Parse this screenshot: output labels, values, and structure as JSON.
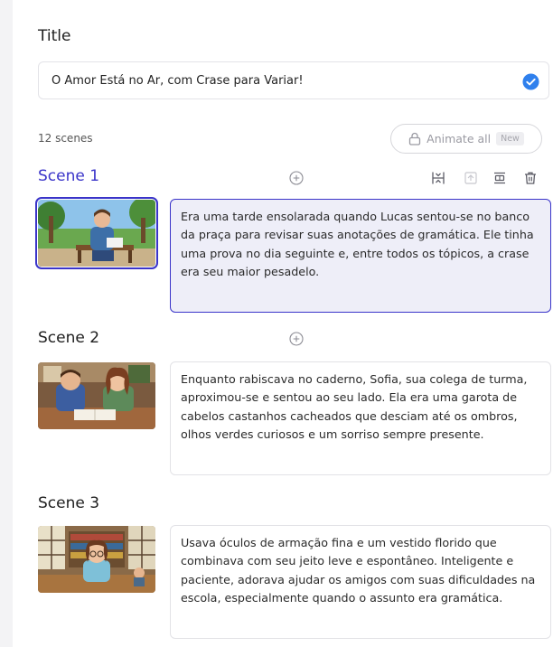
{
  "form": {
    "title_label": "Title",
    "title_value": "O Amor Está no Ar, com Crase para Variar!",
    "scene_count": "12 scenes",
    "animate_all_label": "Animate all",
    "animate_all_badge": "New"
  },
  "scenes": [
    {
      "title": "Scene 1",
      "text": "Era uma tarde ensolarada quando Lucas sentou-se no banco da praça para revisar suas anotações de gramática. Ele tinha uma prova no dia seguinte e, entre todos os tópicos, a crase era seu maior pesadelo."
    },
    {
      "title": "Scene 2",
      "text": "Enquanto rabiscava no caderno, Sofia, sua colega de turma, aproximou-se e sentou ao seu lado. Ela era uma garota de cabelos castanhos cacheados que desciam até os ombros, olhos verdes curiosos e um sorriso sempre presente."
    },
    {
      "title": "Scene 3",
      "text": "Usava óculos de armação fina e um vestido florido que combinava com seu jeito leve e espontâneo. Inteligente e paciente, adorava ajudar os amigos com suas dificuldades na escola, especialmente quando o assunto era gramática."
    }
  ],
  "colors": {
    "accent": "#3a34c9",
    "check": "#2f80ed",
    "active_bg": "#eeeef8"
  },
  "icons": [
    "check-circle-icon",
    "lock-icon",
    "add-circle-icon",
    "split-icon",
    "image-up-icon",
    "text-format-icon",
    "trash-icon"
  ]
}
